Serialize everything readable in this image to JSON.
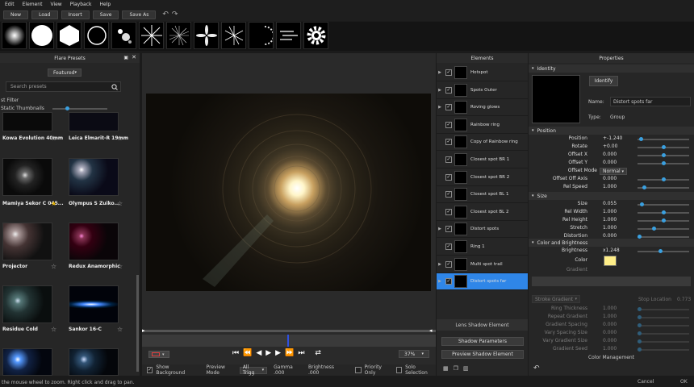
{
  "menu": [
    "Edit",
    "Element",
    "View",
    "Playback",
    "Help"
  ],
  "toolbar": {
    "new": "New",
    "load": "Load",
    "insert": "Insert",
    "save": "Save",
    "save_as": "Save As"
  },
  "left": {
    "title": "Flare Presets",
    "category": "Featured",
    "search_placeholder": "Search presets",
    "filter_label": "st Filter",
    "static_thumbs": "Static Thumbnails",
    "presets": [
      {
        "name": "Kowa Evolution 40mm",
        "fav": false
      },
      {
        "name": "Leica Elmarit-R 19mm",
        "fav": false
      },
      {
        "name": "Mamiya Sekor C 045...",
        "fav": true
      },
      {
        "name": "Olympus S Zuiko...",
        "fav": false
      },
      {
        "name": "Projector",
        "fav": false
      },
      {
        "name": "Redux Anamorphic",
        "fav": false
      },
      {
        "name": "Residue Cold",
        "fav": false
      },
      {
        "name": "Sankor 16-C",
        "fav": false
      }
    ]
  },
  "center": {
    "show_background": "Show Background",
    "preview_mode_label": "Preview Mode",
    "preview_mode": "All Trigg",
    "gamma": "Gamma .000",
    "brightness": "Brightness .000",
    "priority_only": "Priority Only",
    "solo_selection": "Solo Selection",
    "zoom": "37%"
  },
  "elements": {
    "title": "Elements",
    "items": [
      {
        "label": "Hotspot",
        "arrow": true
      },
      {
        "label": "Spots Outer",
        "arrow": true
      },
      {
        "label": "Roving glows",
        "arrow": true
      },
      {
        "label": "Rainbow ring",
        "arrow": false
      },
      {
        "label": "Copy of Rainbow ring",
        "arrow": false
      },
      {
        "label": "Closest spot BR 1",
        "arrow": false
      },
      {
        "label": "Closest spot BR 2",
        "arrow": false
      },
      {
        "label": "Closest spot BL 1",
        "arrow": false
      },
      {
        "label": "Closest spot BL 2",
        "arrow": false
      },
      {
        "label": "Distort spots",
        "arrow": true
      },
      {
        "label": "Ring 1",
        "arrow": false
      },
      {
        "label": "Multi spot trail",
        "arrow": true
      },
      {
        "label": "Distort spots far",
        "arrow": true
      }
    ],
    "lens_shadow": "Lens Shadow Element",
    "shadow_params": "Shadow Parameters",
    "preview_shadow": "Preview Shadow Element"
  },
  "props": {
    "title": "Properties",
    "identity": "Identity",
    "identify": "Identify",
    "name_label": "Name:",
    "name_value": "Distort spots far",
    "type_label": "Type:",
    "type_value": "Group",
    "position_head": "Position",
    "position_rows": [
      {
        "label": "Position",
        "value": "+-1.240",
        "pos": 0.03
      },
      {
        "label": "Rotate",
        "value": "+0.00",
        "pos": 0.5
      },
      {
        "label": "Offset X",
        "value": "0.000",
        "pos": 0.5
      },
      {
        "label": "Offset Y",
        "value": "0.000",
        "pos": 0.5
      }
    ],
    "offset_mode_label": "Offset Mode",
    "offset_mode": "Normal",
    "position_rows2": [
      {
        "label": "Offset Off Axis",
        "value": "0.000",
        "pos": 0.5
      },
      {
        "label": "Rel Speed",
        "value": "1.000",
        "pos": 0.1
      }
    ],
    "size_head": "Size",
    "size_rows": [
      {
        "label": "Size",
        "value": "0.055",
        "pos": 0.05
      },
      {
        "label": "Rel Width",
        "value": "1.000",
        "pos": 0.5
      },
      {
        "label": "Rel Height",
        "value": "1.000",
        "pos": 0.5
      },
      {
        "label": "Stretch",
        "value": "1.000",
        "pos": 0.3
      },
      {
        "label": "Distortion",
        "value": "0.000",
        "pos": 0.0
      }
    ],
    "color_head": "Color and Brightness",
    "brightness_label": "Brightness",
    "brightness_value": "x1.248",
    "color_label": "Color",
    "gradient_label": "Gradient",
    "color_swatch": "#ffee88",
    "gradient_dropdown": "Stroke Gradient",
    "stop_location_label": "Stop Location",
    "stop_location_value": "0.773",
    "gradient_rows": [
      {
        "label": "Ring Thickness",
        "value": "1.000"
      },
      {
        "label": "Repeat Gradient",
        "value": "1.000"
      },
      {
        "label": "Gradient Spacing",
        "value": "0.000"
      },
      {
        "label": "Vary Spacing Size",
        "value": "0.000"
      },
      {
        "label": "Vary Gradient Size",
        "value": "0.000"
      },
      {
        "label": "Gradient Seed",
        "value": "1.000"
      }
    ],
    "color_mgmt": "Color Management"
  },
  "footer": {
    "status": "the mouse wheel to zoom. Right click and drag to pan.",
    "cancel": "Cancel",
    "ok": "OK"
  }
}
